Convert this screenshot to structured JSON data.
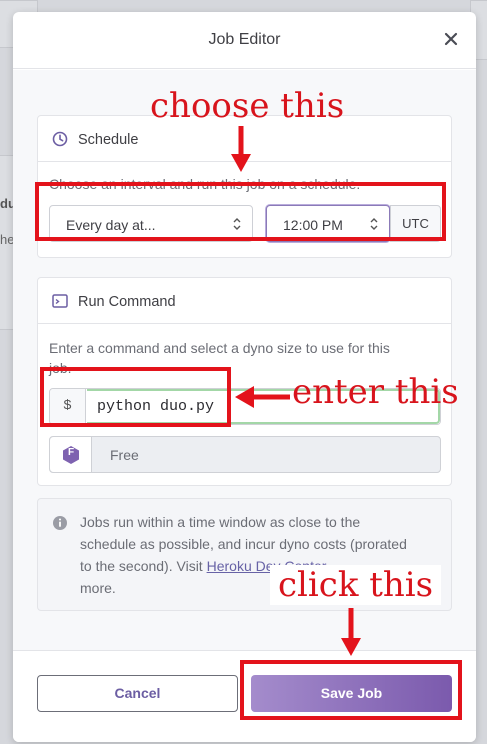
{
  "background": {
    "partial_bold_text": "du",
    "partial_text": "he"
  },
  "modal": {
    "title": "Job Editor",
    "close_icon": "close-icon"
  },
  "schedule": {
    "heading": "Schedule",
    "icon": "clock-icon",
    "description": "Choose an interval and run this job on a schedule.",
    "interval_value": "Every day at...",
    "time_value": "12:00 PM",
    "timezone": "UTC"
  },
  "run_command": {
    "heading": "Run Command",
    "icon": "terminal-icon",
    "description_line1": "Enter a command and select a dyno size to use for this",
    "description_line2": "job.",
    "prefix": "$",
    "command_value": "python duo.py",
    "dyno_badge": "F",
    "dyno_size": "Free"
  },
  "info": {
    "icon": "info-icon",
    "line1": "Jobs run within a time window as close to the",
    "line2": "schedule as possible, and incur dyno costs (prorated",
    "line3_prefix": "to the second). Visit ",
    "link_text": "Heroku Dev Center",
    "line4": "more."
  },
  "footer": {
    "cancel_label": "Cancel",
    "save_label": "Save Job"
  },
  "annotations": {
    "choose": "choose this",
    "enter": "enter this",
    "click": "click this"
  },
  "colors": {
    "annotation_red": "#e3131b",
    "save_gradient_start": "#a48ccc",
    "save_gradient_end": "#7b5aad",
    "accent_purple": "#6c5ea3"
  }
}
